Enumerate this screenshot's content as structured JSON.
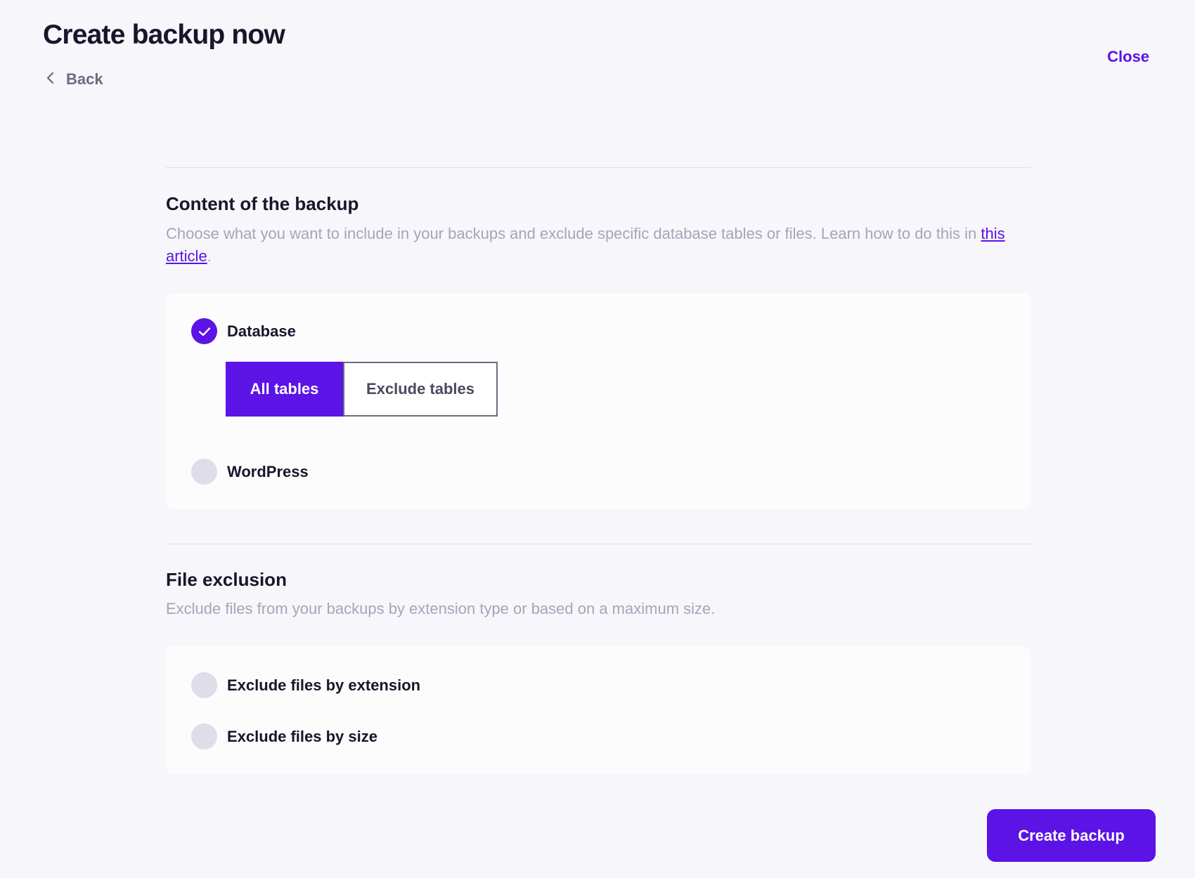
{
  "header": {
    "title": "Create backup now",
    "back_label": "Back",
    "close_label": "Close"
  },
  "content_section": {
    "title": "Content of the backup",
    "description_prefix": "Choose what you want to include in your backups and exclude specific database tables or files. Learn how to do this in ",
    "link_text": "this article",
    "description_suffix": ".",
    "options": [
      {
        "label": "Database",
        "checked": true
      },
      {
        "label": "WordPress",
        "checked": false
      }
    ],
    "table_mode": {
      "options": [
        "All tables",
        "Exclude tables"
      ],
      "selected": "All tables"
    }
  },
  "file_exclusion_section": {
    "title": "File exclusion",
    "description": "Exclude files from your backups by extension type or based on a maximum size.",
    "options": [
      {
        "label": "Exclude files by extension",
        "checked": false
      },
      {
        "label": "Exclude files by size",
        "checked": false
      }
    ]
  },
  "footer": {
    "create_button_label": "Create backup"
  },
  "colors": {
    "accent": "#5b13e6",
    "background": "#f6f6fb",
    "card": "#fcfcfd",
    "radio_unchecked": "#dedde9"
  }
}
